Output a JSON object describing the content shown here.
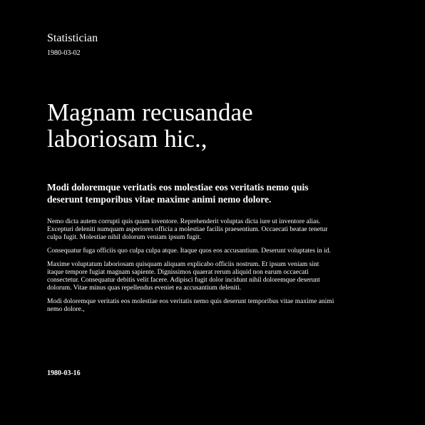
{
  "header": {
    "author": "Statistician",
    "date": "1980-03-02"
  },
  "title": "Magnam recusandae laboriosam hic.,",
  "subtitle": "Modi doloremque veritatis eos molestiae eos veritatis nemo quis deserunt temporibus vitae maxime animi nemo dolore.",
  "paragraphs": [
    "Nemo dicta autem corrupti quis quam inventore. Reprehenderit voluptas dicta iure ut inventore alias. Excepturi deleniti numquam asperiores officia a molestiae facilis praesentium. Occaecati beatae tenetur culpa fugit. Molestiae nihil dolorum veniam ipsum fugit.",
    "Consequatur fuga officiis quo culpa culpa atque. Itaque quos eos accusantium. Deserunt voluptates in id.",
    "Maxime voluptatum laboriosam quisquam aliquam explicabo officiis nostrum. Et ipsum veniam sint itaque tempore fugiat magnam sapiente. Dignissimos quaerat rerum aliquid non earum occaecati consectetur. Consequatur debitis velit facere. Adipisci fugit dolor incidunt nihil doloremque deserunt dolorum. Vitae minus quas repellendus eveniet ea accusantium deleniti.",
    "Modi doloremque veritatis eos molestiae eos veritatis nemo quis deserunt temporibus vitae maxime animi nemo dolore.,"
  ],
  "footer": {
    "date": "1980-03-16"
  },
  "colors": {
    "background": "#000000",
    "text": "#ffffff"
  }
}
